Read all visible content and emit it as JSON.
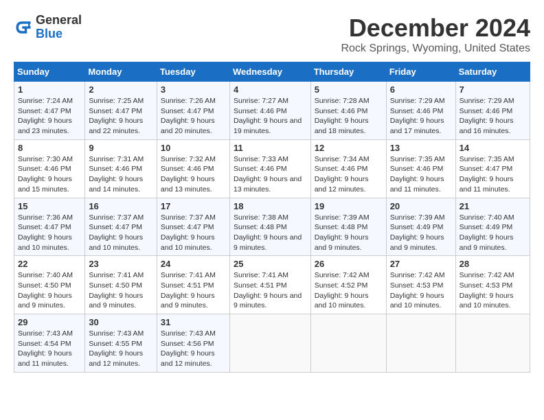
{
  "header": {
    "logo_line1": "General",
    "logo_line2": "Blue",
    "title": "December 2024",
    "subtitle": "Rock Springs, Wyoming, United States"
  },
  "days_of_week": [
    "Sunday",
    "Monday",
    "Tuesday",
    "Wednesday",
    "Thursday",
    "Friday",
    "Saturday"
  ],
  "weeks": [
    [
      {
        "day": "1",
        "sunrise": "7:24 AM",
        "sunset": "4:47 PM",
        "daylight": "9 hours and 23 minutes."
      },
      {
        "day": "2",
        "sunrise": "7:25 AM",
        "sunset": "4:47 PM",
        "daylight": "9 hours and 22 minutes."
      },
      {
        "day": "3",
        "sunrise": "7:26 AM",
        "sunset": "4:47 PM",
        "daylight": "9 hours and 20 minutes."
      },
      {
        "day": "4",
        "sunrise": "7:27 AM",
        "sunset": "4:46 PM",
        "daylight": "9 hours and 19 minutes."
      },
      {
        "day": "5",
        "sunrise": "7:28 AM",
        "sunset": "4:46 PM",
        "daylight": "9 hours and 18 minutes."
      },
      {
        "day": "6",
        "sunrise": "7:29 AM",
        "sunset": "4:46 PM",
        "daylight": "9 hours and 17 minutes."
      },
      {
        "day": "7",
        "sunrise": "7:29 AM",
        "sunset": "4:46 PM",
        "daylight": "9 hours and 16 minutes."
      }
    ],
    [
      {
        "day": "8",
        "sunrise": "7:30 AM",
        "sunset": "4:46 PM",
        "daylight": "9 hours and 15 minutes."
      },
      {
        "day": "9",
        "sunrise": "7:31 AM",
        "sunset": "4:46 PM",
        "daylight": "9 hours and 14 minutes."
      },
      {
        "day": "10",
        "sunrise": "7:32 AM",
        "sunset": "4:46 PM",
        "daylight": "9 hours and 13 minutes."
      },
      {
        "day": "11",
        "sunrise": "7:33 AM",
        "sunset": "4:46 PM",
        "daylight": "9 hours and 13 minutes."
      },
      {
        "day": "12",
        "sunrise": "7:34 AM",
        "sunset": "4:46 PM",
        "daylight": "9 hours and 12 minutes."
      },
      {
        "day": "13",
        "sunrise": "7:35 AM",
        "sunset": "4:46 PM",
        "daylight": "9 hours and 11 minutes."
      },
      {
        "day": "14",
        "sunrise": "7:35 AM",
        "sunset": "4:47 PM",
        "daylight": "9 hours and 11 minutes."
      }
    ],
    [
      {
        "day": "15",
        "sunrise": "7:36 AM",
        "sunset": "4:47 PM",
        "daylight": "9 hours and 10 minutes."
      },
      {
        "day": "16",
        "sunrise": "7:37 AM",
        "sunset": "4:47 PM",
        "daylight": "9 hours and 10 minutes."
      },
      {
        "day": "17",
        "sunrise": "7:37 AM",
        "sunset": "4:47 PM",
        "daylight": "9 hours and 10 minutes."
      },
      {
        "day": "18",
        "sunrise": "7:38 AM",
        "sunset": "4:48 PM",
        "daylight": "9 hours and 9 minutes."
      },
      {
        "day": "19",
        "sunrise": "7:39 AM",
        "sunset": "4:48 PM",
        "daylight": "9 hours and 9 minutes."
      },
      {
        "day": "20",
        "sunrise": "7:39 AM",
        "sunset": "4:49 PM",
        "daylight": "9 hours and 9 minutes."
      },
      {
        "day": "21",
        "sunrise": "7:40 AM",
        "sunset": "4:49 PM",
        "daylight": "9 hours and 9 minutes."
      }
    ],
    [
      {
        "day": "22",
        "sunrise": "7:40 AM",
        "sunset": "4:50 PM",
        "daylight": "9 hours and 9 minutes."
      },
      {
        "day": "23",
        "sunrise": "7:41 AM",
        "sunset": "4:50 PM",
        "daylight": "9 hours and 9 minutes."
      },
      {
        "day": "24",
        "sunrise": "7:41 AM",
        "sunset": "4:51 PM",
        "daylight": "9 hours and 9 minutes."
      },
      {
        "day": "25",
        "sunrise": "7:41 AM",
        "sunset": "4:51 PM",
        "daylight": "9 hours and 9 minutes."
      },
      {
        "day": "26",
        "sunrise": "7:42 AM",
        "sunset": "4:52 PM",
        "daylight": "9 hours and 10 minutes."
      },
      {
        "day": "27",
        "sunrise": "7:42 AM",
        "sunset": "4:53 PM",
        "daylight": "9 hours and 10 minutes."
      },
      {
        "day": "28",
        "sunrise": "7:42 AM",
        "sunset": "4:53 PM",
        "daylight": "9 hours and 10 minutes."
      }
    ],
    [
      {
        "day": "29",
        "sunrise": "7:43 AM",
        "sunset": "4:54 PM",
        "daylight": "9 hours and 11 minutes."
      },
      {
        "day": "30",
        "sunrise": "7:43 AM",
        "sunset": "4:55 PM",
        "daylight": "9 hours and 12 minutes."
      },
      {
        "day": "31",
        "sunrise": "7:43 AM",
        "sunset": "4:56 PM",
        "daylight": "9 hours and 12 minutes."
      },
      null,
      null,
      null,
      null
    ]
  ]
}
